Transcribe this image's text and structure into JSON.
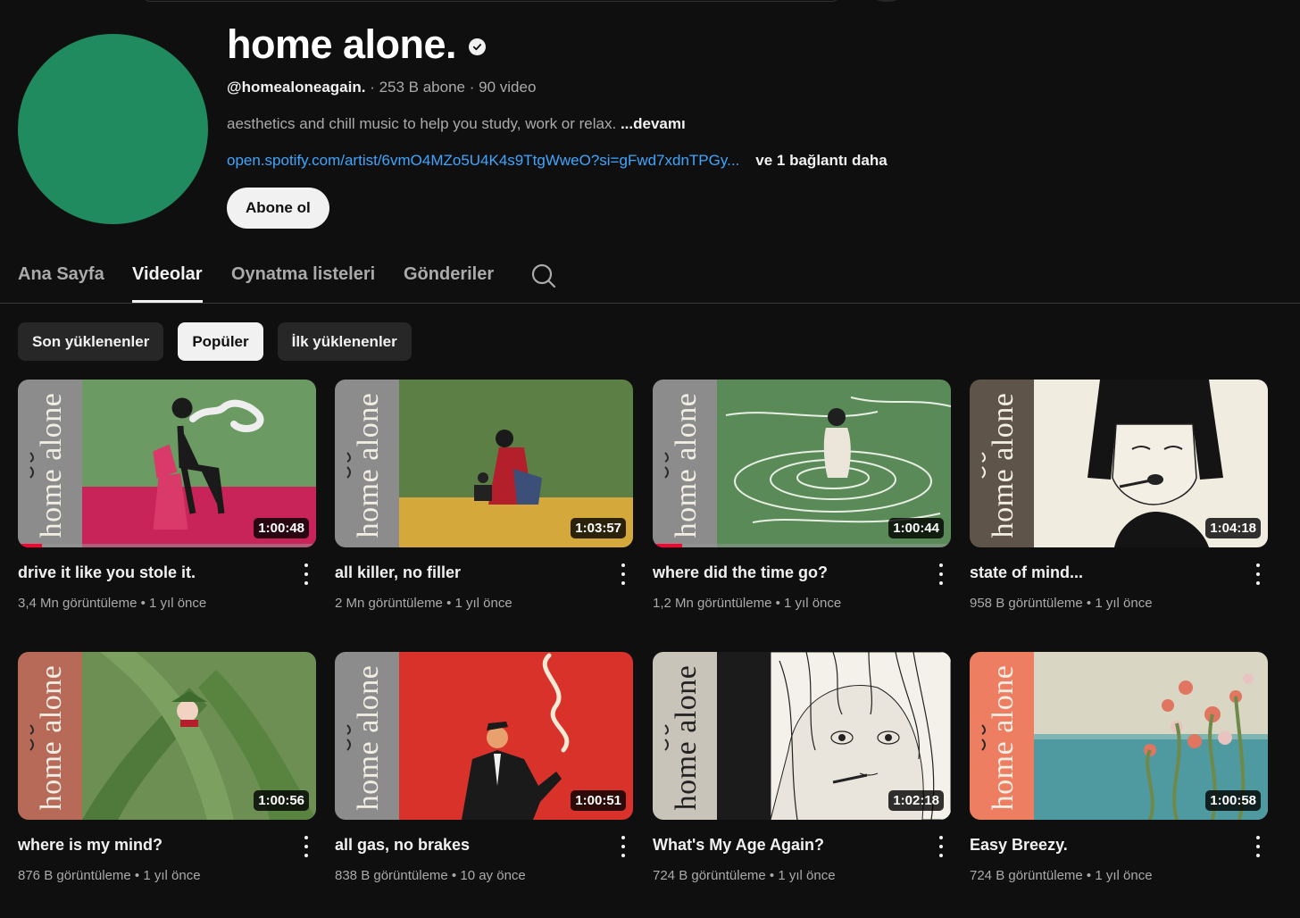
{
  "channel": {
    "title": "home alone.",
    "handle": "@homealoneagain.",
    "subscribers": "253 B abone",
    "video_count": "90 video",
    "description": "aesthetics and chill music to help you study, work or relax.",
    "more_label": "...devamı",
    "link": "open.spotify.com/artist/6vmO4MZo5U4K4s9TtgWweO?si=gFwd7xdnTPGy...",
    "extra_links": "ve 1 bağlantı daha",
    "subscribe_label": "Abone ol",
    "avatar_color": "#208b5e",
    "verified_icon": "verified-check-icon"
  },
  "tabs": [
    {
      "label": "Ana Sayfa"
    },
    {
      "label": "Videolar"
    },
    {
      "label": "Oynatma listeleri"
    },
    {
      "label": "Gönderiler"
    }
  ],
  "active_tab": "Videolar",
  "search_icon": "search-icon",
  "chips": [
    {
      "label": "Son yüklenenler"
    },
    {
      "label": "Popüler"
    },
    {
      "label": "İlk yüklenenler"
    }
  ],
  "active_chip": "Popüler",
  "thumb_spine_text": "home alone",
  "videos": [
    {
      "title": "drive it like you stole it.",
      "views": "3,4 Mn görüntüleme",
      "age": "1 yıl önce",
      "duration": "1:00:48",
      "watched_fraction": 0.08,
      "spine_color": "#8c8c8c",
      "art": "green-pink-smoker"
    },
    {
      "title": "all killer, no filler",
      "views": "2 Mn görüntüleme",
      "age": "1 yıl önce",
      "duration": "1:03:57",
      "watched_fraction": 0,
      "spine_color": "#8c8c8c",
      "art": "green-yellow-geisha"
    },
    {
      "title": "where did the time go?",
      "views": "1,2 Mn görüntüleme",
      "age": "1 yıl önce",
      "duration": "1:00:44",
      "watched_fraction": 0.1,
      "spine_color": "#8c8c8c",
      "art": "green-water-swimmer"
    },
    {
      "title": "state of mind...",
      "views": "958 B görüntüleme",
      "age": "1 yıl önce",
      "duration": "1:04:18",
      "watched_fraction": 0,
      "spine_color": "#5e5449",
      "art": "bob-hair-girl"
    },
    {
      "title": "where is my mind?",
      "views": "876 B görüntüleme",
      "age": "1 yıl önce",
      "duration": "1:00:56",
      "watched_fraction": 0,
      "spine_color": "#b86a58",
      "art": "leaves-woman"
    },
    {
      "title": "all gas, no brakes",
      "views": "838 B görüntüleme",
      "age": "10 ay önce",
      "duration": "1:00:51",
      "watched_fraction": 0,
      "spine_color": "#8c8c8c",
      "art": "red-smoking-man"
    },
    {
      "title": "What's My Age Again?",
      "views": "724 B görüntüleme",
      "age": "1 yıl önce",
      "duration": "1:02:18",
      "watched_fraction": 0,
      "spine_color": "#c9c4ba",
      "art": "manga-girl"
    },
    {
      "title": "Easy Breezy.",
      "views": "724 B görüntüleme",
      "age": "1 yıl önce",
      "duration": "1:00:58",
      "watched_fraction": 0,
      "spine_color": "#ee7e62",
      "art": "sea-flowers"
    }
  ]
}
